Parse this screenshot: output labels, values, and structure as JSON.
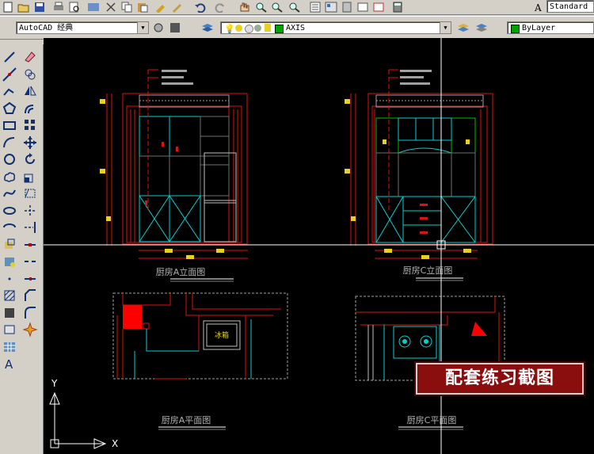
{
  "toolbar_top": {
    "textstyle_value": "Standard",
    "icons": [
      "new-icon",
      "open-icon",
      "save-icon",
      "plot-icon",
      "preview-icon",
      "publish-icon",
      "cut-icon",
      "copy-icon",
      "paste-icon",
      "match-prop-icon",
      "brush-icon",
      "undo-icon",
      "redo-icon",
      "pan-icon",
      "zoom-realtime-icon",
      "zoom-window-icon",
      "zoom-prev-icon",
      "properties-icon",
      "design-center-icon",
      "tool-palette-icon",
      "sheet-set-icon",
      "markup-icon",
      "calculator-icon"
    ]
  },
  "toolbar_second": {
    "workspace_value": "AutoCAD 经典",
    "layer_value": "AXIS",
    "color_value": "ByLayer",
    "colors": {
      "layer_swatch": "#00a000",
      "color_swatch": "#00a000"
    }
  },
  "left_tools": {
    "draw": [
      "line-icon",
      "construction-line-icon",
      "polyline-icon",
      "polygon-icon",
      "rectangle-icon",
      "arc-icon",
      "circle-icon",
      "revcloud-icon",
      "spline-icon",
      "ellipse-icon",
      "ellipse-arc-icon",
      "insert-block-icon",
      "make-block-icon",
      "point-icon",
      "hatch-icon",
      "gradient-icon",
      "region-icon",
      "table-icon",
      "multiline-text-icon"
    ],
    "modify": [
      "erase-icon",
      "copy-object-icon",
      "mirror-icon",
      "offset-icon",
      "array-icon",
      "move-icon",
      "rotate-icon",
      "scale-icon",
      "stretch-icon",
      "trim-icon",
      "extend-icon",
      "break-at-point-icon",
      "break-icon",
      "join-icon",
      "chamfer-icon",
      "fillet-icon",
      "explode-icon"
    ]
  },
  "drawing": {
    "label_a_elev": "厨房A立面图",
    "label_c_elev": "厨房C立面图",
    "label_a_plan": "厨房A平面图",
    "label_c_plan": "厨房C平面图",
    "fridge_text": "冰箱",
    "ucs_x": "X",
    "ucs_y": "Y"
  },
  "banner": {
    "text": "配套练习截图"
  }
}
